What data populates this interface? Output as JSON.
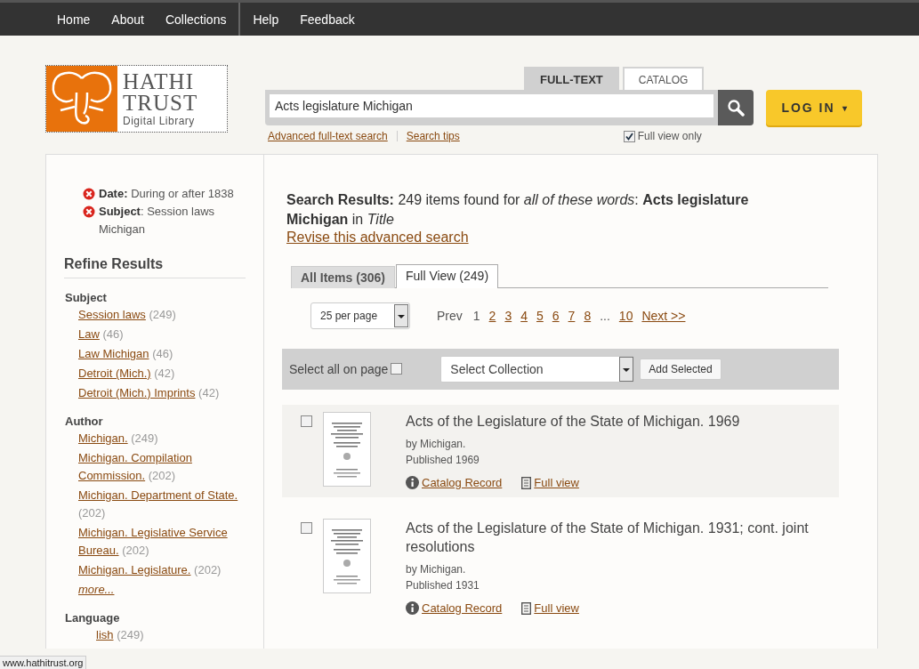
{
  "nav": [
    {
      "label": "Home"
    },
    {
      "label": "About"
    },
    {
      "label": "Collections"
    },
    {
      "label": "Help"
    },
    {
      "label": "Feedback"
    }
  ],
  "logo": {
    "line1": "HATHI",
    "line2": "TRUST",
    "line3": "Digital Library"
  },
  "search": {
    "tabs": [
      {
        "label": "FULL-TEXT",
        "selected": true
      },
      {
        "label": "CATALOG",
        "selected": false
      }
    ],
    "value": "Acts legislature Michigan",
    "links": [
      "Advanced full-text search",
      "Search tips"
    ],
    "full_view_only": {
      "label": "Full view only",
      "checked": true
    }
  },
  "login": {
    "label": "LOG IN",
    "caret": "▾"
  },
  "filters": [
    {
      "text": "**Date:** During or after 1838"
    },
    {
      "text": "**Subject**: Session laws Michigan"
    }
  ],
  "refine": {
    "title": "Refine Results",
    "groups": [
      {
        "name": "Subject",
        "items": [
          {
            "label": "Session laws",
            "count": "(249)"
          },
          {
            "label": "Law",
            "count": "(46)"
          },
          {
            "label": "Law Michigan",
            "count": "(46)"
          },
          {
            "label": "Detroit (Mich.)",
            "count": "(42)"
          },
          {
            "label": "Detroit (Mich.) Imprints",
            "count": "(42)"
          }
        ]
      },
      {
        "name": "Author",
        "items": [
          {
            "label": "Michigan.",
            "count": "(249)"
          },
          {
            "label": "Michigan. Compilation Commission.",
            "count": "(202)"
          },
          {
            "label": "Michigan. Department of State.",
            "count": "(202)"
          },
          {
            "label": "Michigan. Legislative Service Bureau.",
            "count": "(202)"
          },
          {
            "label": "Michigan. Legislature.",
            "count": "(202)"
          }
        ],
        "more": "more..."
      },
      {
        "name": "Language",
        "items": [
          {
            "label": "lish",
            "count": "(249)"
          }
        ]
      }
    ]
  },
  "results": {
    "summary": "**Search Results:** 249 items found for *all of these words*: **Acts legislature Michigan** in *Title*",
    "revise": "Revise this advanced search",
    "tabs": [
      {
        "label": "All Items (306)",
        "selected": false
      },
      {
        "label": "Full View (249)",
        "selected": true
      }
    ],
    "per_page": "25 per page",
    "pager": [
      {
        "label": "Prev",
        "kind": "text"
      },
      {
        "label": "1",
        "kind": "current"
      },
      {
        "label": "2",
        "kind": "link"
      },
      {
        "label": "3",
        "kind": "link"
      },
      {
        "label": "4",
        "kind": "link"
      },
      {
        "label": "5",
        "kind": "link"
      },
      {
        "label": "6",
        "kind": "link"
      },
      {
        "label": "7",
        "kind": "link"
      },
      {
        "label": "8",
        "kind": "link"
      },
      {
        "label": "...",
        "kind": "text"
      },
      {
        "label": "10",
        "kind": "link"
      },
      {
        "label": "Next >>",
        "kind": "link"
      }
    ],
    "toolbar": {
      "select_all": "Select all on page",
      "select_all_checked": false,
      "collection": "Select Collection",
      "add": "Add Selected"
    },
    "items": [
      {
        "title": "Acts of the Legislature of the State of Michigan. 1969",
        "author": "by Michigan.",
        "published": "Published 1969",
        "checked": false,
        "catalog": "Catalog Record",
        "full_view": "Full view"
      },
      {
        "title": "Acts of the Legislature of the State of Michigan. 1931; cont. joint resolutions",
        "author": "by Michigan.",
        "published": "Published 1931",
        "checked": false,
        "catalog": "Catalog Record",
        "full_view": "Full view"
      }
    ]
  },
  "status_bar": "www.hathitrust.org"
}
